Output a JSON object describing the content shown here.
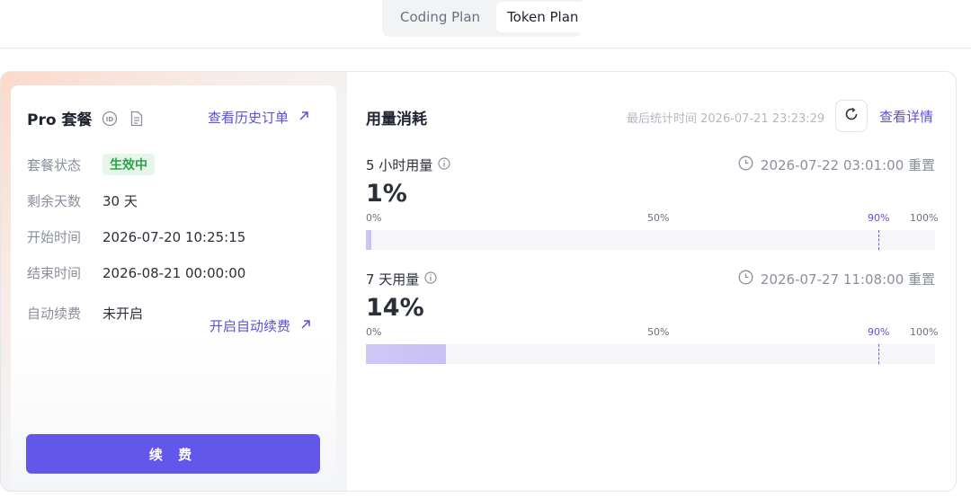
{
  "tabs": [
    {
      "label": "Coding Plan",
      "active": false
    },
    {
      "label": "Token Plan",
      "active": true
    }
  ],
  "plan": {
    "title": "Pro 套餐",
    "history_link": "查看历史订单",
    "rows": {
      "status": {
        "label": "套餐状态",
        "value": "生效中"
      },
      "remaining": {
        "label": "剩余天数",
        "value": "30 天"
      },
      "start": {
        "label": "开始时间",
        "value": "2026-07-20 10:25:15"
      },
      "end": {
        "label": "结束时间",
        "value": "2026-08-21 00:00:00"
      },
      "auto_renew": {
        "label": "自动续费",
        "value": "未开启",
        "link": "开启自动续费"
      }
    },
    "renew_button": "续 费"
  },
  "usage": {
    "title": "用量消耗",
    "last_stat": "最后统计时间 2026-07-21 23:23:29",
    "detail_link": "查看详情",
    "sections": [
      {
        "label": "5 小时用量",
        "reset": "2026-07-22 03:01:00 重置",
        "percent_text": "1%",
        "fill_fraction": 0.01
      },
      {
        "label": "7 天用量",
        "reset": "2026-07-27 11:08:00 重置",
        "percent_text": "14%",
        "fill_fraction": 0.14
      }
    ],
    "scale": {
      "p0": "0%",
      "p50": "50%",
      "p90": "90%",
      "p100": "100%"
    }
  },
  "colors": {
    "accent": "#6257ea",
    "status_green": "#2ea24a"
  }
}
